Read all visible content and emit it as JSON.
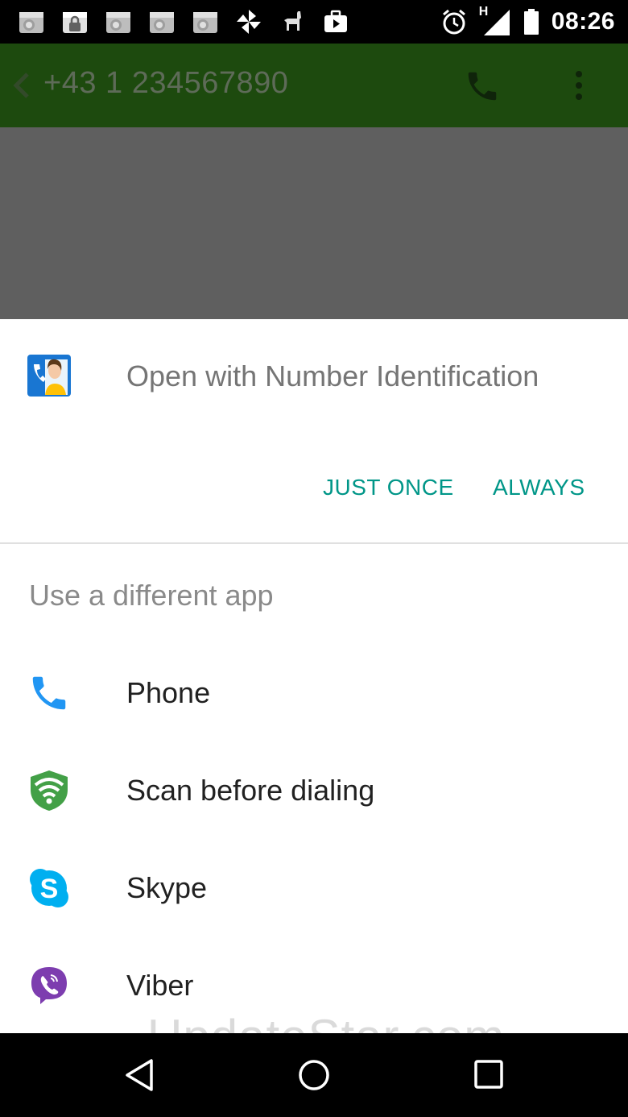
{
  "status_bar": {
    "time": "08:26",
    "network_type": "H",
    "left_icons": [
      "calendar-notification-icon",
      "lock-notification-icon",
      "calendar-notification-icon",
      "calendar-notification-icon",
      "calendar-notification-icon",
      "pinwheel-icon",
      "llama-icon",
      "briefcase-play-icon"
    ]
  },
  "app_bar": {
    "phone_number": "+43 1 234567890"
  },
  "chooser": {
    "title": "Open with Number Identification",
    "just_once_label": "JUST ONCE",
    "always_label": "ALWAYS",
    "subheader": "Use a different app",
    "apps": [
      {
        "label": "Phone",
        "icon": "phone-icon",
        "color": "#2196f3"
      },
      {
        "label": "Scan before dialing",
        "icon": "wifi-shield-icon",
        "color": "#43a047"
      },
      {
        "label": "Skype",
        "icon": "skype-icon",
        "color": "#00aff0"
      },
      {
        "label": "Viber",
        "icon": "viber-icon",
        "color": "#7d3daf"
      }
    ]
  },
  "watermark": "UpdateStar.com",
  "colors": {
    "accent": "#009688",
    "app_bar": "#1d4a0e",
    "scrim": "#5f5f5f"
  }
}
